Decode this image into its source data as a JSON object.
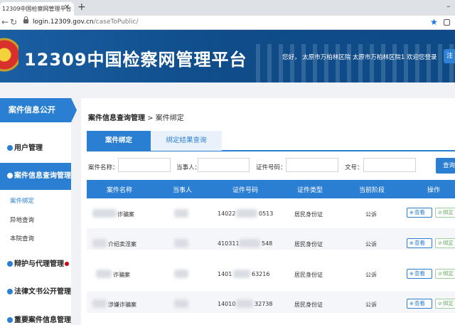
{
  "browser": {
    "tab_title": "12309中国检察网管理平台",
    "close_glyph": "✕",
    "new_tab_glyph": "+",
    "url_domain": "login.12309.gov.cn",
    "url_path": "/caseToPublic/"
  },
  "header": {
    "logo_text": "12309中国检察网管理平台",
    "welcome": "您好，  太原市万柏林区院  太原市万柏林区院1  欢迎您登录",
    "button_label": "注"
  },
  "sidebar": {
    "title": "案件信息公开",
    "items": [
      {
        "label": "用户管理",
        "icon": "user-icon"
      },
      {
        "label": "案件信息查询管理",
        "icon": "list-icon"
      },
      {
        "label": "辩护与代理管理",
        "icon": "pen-icon"
      },
      {
        "label": "法律文书公开管理",
        "icon": "doc-icon"
      },
      {
        "label": "重要案件信息管理",
        "icon": "doc-icon"
      }
    ],
    "subitems": [
      "案件绑定",
      "异地查询",
      "本院查询"
    ]
  },
  "main": {
    "breadcrumb_main": "案件信息查询管理",
    "breadcrumb_sep": " > ",
    "breadcrumb_current": "案件绑定",
    "tabs": [
      "案件绑定",
      "绑定结果查询"
    ],
    "filters": [
      {
        "label": "案件名称：",
        "value": ""
      },
      {
        "label": "当事人：",
        "value": ""
      },
      {
        "label": "证件号码：",
        "value": ""
      },
      {
        "label": "文号：",
        "value": ""
      }
    ],
    "query_label": "查询"
  },
  "table": {
    "headers": [
      "案件名称",
      "当事人",
      "证件号码",
      "证件类型",
      "当前阶段",
      "操作"
    ],
    "view_label": "查看",
    "bind_label": "绑定",
    "rows": [
      {
        "name": "诈骗案",
        "id_head": "14022",
        "id_tail": "0513",
        "id_type": "居民身份证",
        "stage": "公诉"
      },
      {
        "name": "介绍卖淫案",
        "id_head": "410311",
        "id_tail": "548",
        "id_type": "居民身份证",
        "stage": "公诉"
      },
      {
        "name": "诈骗案",
        "id_head": "1401",
        "id_tail": "63216",
        "id_type": "居民身份证",
        "stage": "公诉"
      },
      {
        "name": "涉嫌诈骗案",
        "id_head": "14010",
        "id_tail": "32738",
        "id_type": "居民身份证",
        "stage": "公诉"
      }
    ]
  },
  "colors": {
    "primary": "#2b7fd3",
    "banner": "#0f4c89",
    "alert": "#d0021b"
  }
}
